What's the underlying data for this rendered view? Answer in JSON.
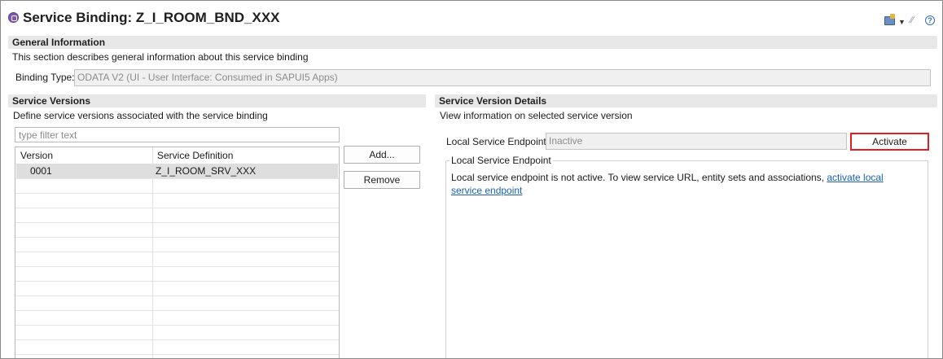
{
  "header": {
    "title": "Service Binding: Z_I_ROOM_BND_XXX",
    "toolbar_icons": [
      "app-icon",
      "dropdown-icon",
      "link-icon",
      "help-icon"
    ]
  },
  "general": {
    "header": "General Information",
    "description": "This section describes general information about this service binding",
    "binding_type_label": "Binding Type:",
    "binding_type_value": "ODATA V2 (UI - User Interface: Consumed in SAPUI5 Apps)"
  },
  "versions": {
    "header": "Service Versions",
    "description": "Define service versions associated with the service binding",
    "filter_placeholder": "type filter text",
    "columns": [
      "Version",
      "Service Definition"
    ],
    "rows": [
      {
        "version": "0001",
        "definition": "Z_I_ROOM_SRV_XXX"
      }
    ],
    "add_label": "Add...",
    "remove_label": "Remove"
  },
  "details": {
    "header": "Service Version Details",
    "description": "View information on selected service version",
    "endpoint_label": "Local Service Endpoint:",
    "endpoint_value": "Inactive",
    "activate_label": "Activate",
    "group_title": "Local Service Endpoint",
    "message": "Local service endpoint is not active. To view service URL, entity sets and associations, ",
    "link_text": "activate local service endpoint"
  },
  "colors": {
    "section_header_bg": "#e8e8e8",
    "highlight_border": "#e02020",
    "link": "#1a5fb4",
    "selected_row": "#dedede"
  }
}
